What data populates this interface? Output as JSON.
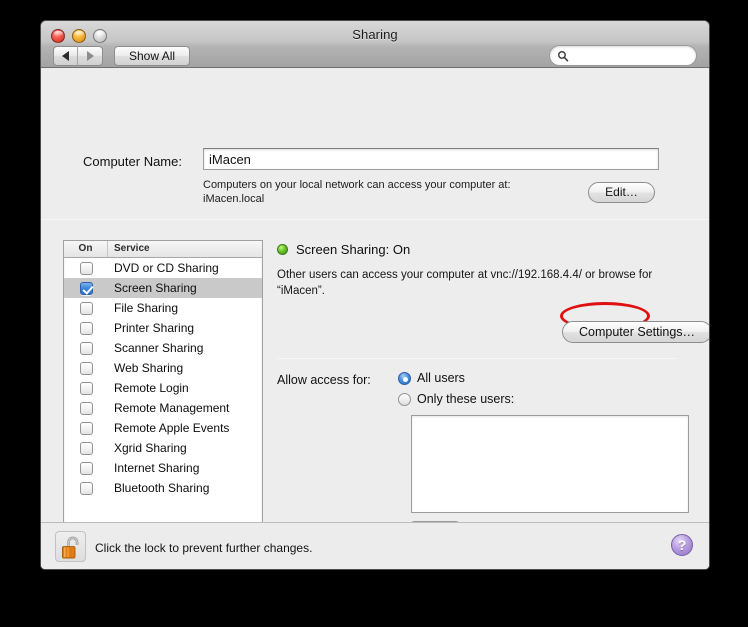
{
  "window": {
    "title": "Sharing",
    "traffic_lights": {
      "close": "close",
      "minimize": "minimize",
      "zoom": "zoom"
    }
  },
  "toolbar": {
    "back_label": "◀",
    "forward_label": "▶",
    "show_all_label": "Show All",
    "search_placeholder": "",
    "search_value": ""
  },
  "computer_name": {
    "label": "Computer Name:",
    "value": "iMacen",
    "description_line1": "Computers on your local network can access your computer at:",
    "description_line2": "iMacen.local",
    "edit_label": "Edit…"
  },
  "service_list": {
    "header_on": "On",
    "header_service": "Service",
    "rows": [
      {
        "name": "DVD or CD Sharing",
        "checked": false,
        "selected": false
      },
      {
        "name": "Screen Sharing",
        "checked": true,
        "selected": true
      },
      {
        "name": "File Sharing",
        "checked": false,
        "selected": false
      },
      {
        "name": "Printer Sharing",
        "checked": false,
        "selected": false
      },
      {
        "name": "Scanner Sharing",
        "checked": false,
        "selected": false
      },
      {
        "name": "Web Sharing",
        "checked": false,
        "selected": false
      },
      {
        "name": "Remote Login",
        "checked": false,
        "selected": false
      },
      {
        "name": "Remote Management",
        "checked": false,
        "selected": false
      },
      {
        "name": "Remote Apple Events",
        "checked": false,
        "selected": false
      },
      {
        "name": "Xgrid Sharing",
        "checked": false,
        "selected": false
      },
      {
        "name": "Internet Sharing",
        "checked": false,
        "selected": false
      },
      {
        "name": "Bluetooth Sharing",
        "checked": false,
        "selected": false
      }
    ]
  },
  "detail": {
    "status_text": "Screen Sharing: On",
    "status_color": "#5cb814",
    "description": "Other users can access your computer at vnc://192.168.4.4/ or browse for “iMacen”.",
    "vnc_address": "vnc://192.168.4.4/",
    "computer_settings_label": "Computer Settings…",
    "annotation_color": "#e01010"
  },
  "access": {
    "label": "Allow access for:",
    "options": [
      {
        "label": "All users",
        "selected": true
      },
      {
        "label": "Only these users:",
        "selected": false
      }
    ],
    "users": [],
    "add_label": "+",
    "remove_label": "−"
  },
  "bottom_bar": {
    "lock_text": "Click the lock to prevent further changes.",
    "lock_state": "unlocked",
    "help_label": "?"
  }
}
